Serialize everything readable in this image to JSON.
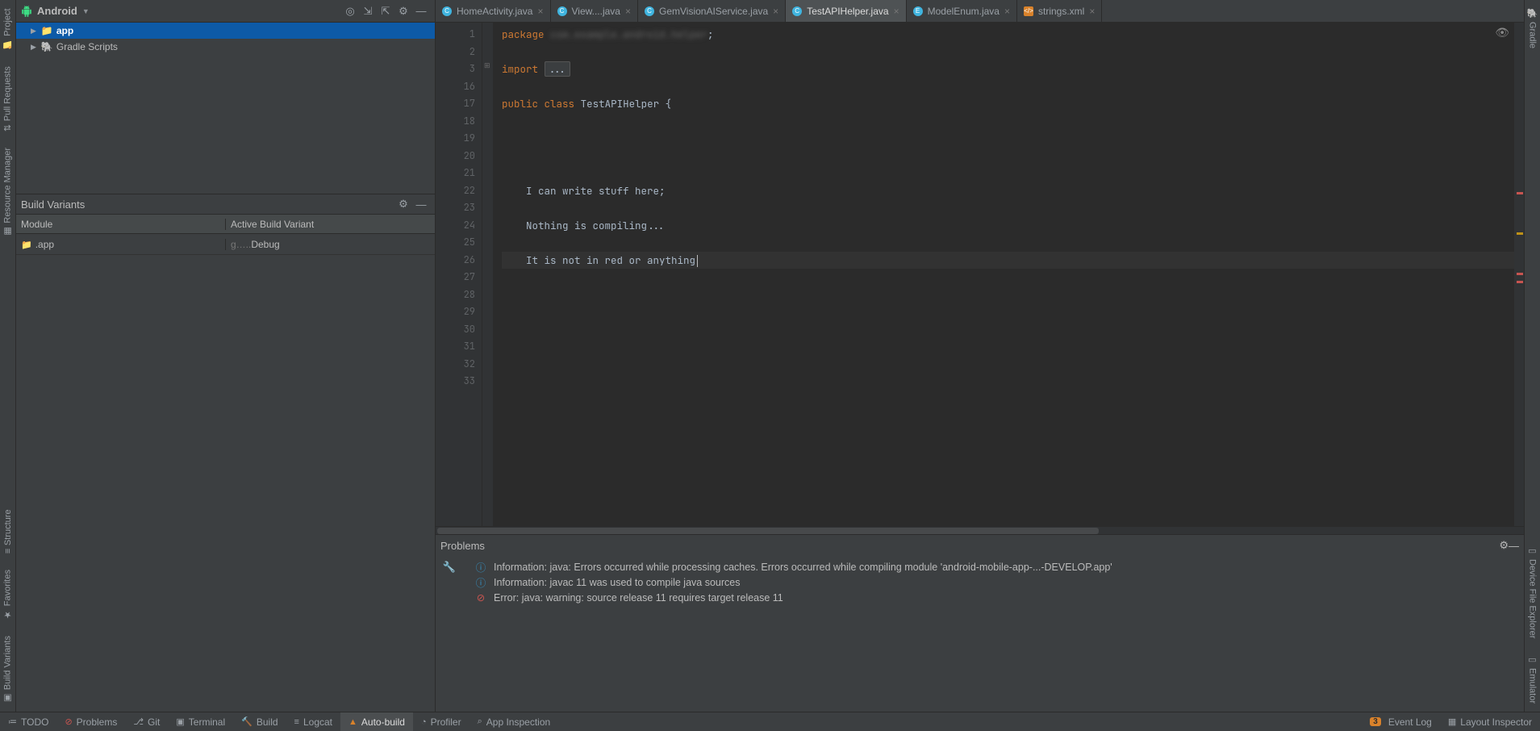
{
  "left_gutter": {
    "project": "Project",
    "pull_requests": "Pull Requests",
    "resource_manager": "Resource Manager",
    "structure": "Structure",
    "favorites": "Favorites",
    "build_variants": "Build Variants"
  },
  "right_gutter": {
    "gradle": "Gradle",
    "device_file_explorer": "Device File Explorer",
    "emulator": "Emulator"
  },
  "project_panel": {
    "dropdown": "Android",
    "tree": {
      "app": "app",
      "gradle_scripts": "Gradle Scripts"
    }
  },
  "build_variants": {
    "title": "Build Variants",
    "col_module": "Module",
    "col_variant": "Active Build Variant",
    "row_module": ".app",
    "row_variant_suffix": "Debug"
  },
  "tabs": [
    {
      "label": "HomeActivity.java",
      "type": "c"
    },
    {
      "label": "View....java",
      "type": "c"
    },
    {
      "label": "GemVisionAIService.java",
      "type": "c"
    },
    {
      "label": "TestAPIHelper.java",
      "type": "c",
      "active": true
    },
    {
      "label": "ModelEnum.java",
      "type": "e"
    },
    {
      "label": "strings.xml",
      "type": "xml"
    }
  ],
  "editor": {
    "package_kw": "package",
    "package_tail": ";",
    "import_kw": "import",
    "import_fold": "...",
    "decl_public": "public",
    "decl_class": "class",
    "decl_name": "TestAPIHelper",
    "decl_tail": " {",
    "line22": "I can write stuff here;",
    "line24": "Nothing is compiling...",
    "line26": "It is not in red or anything",
    "line_numbers": [
      "1",
      "2",
      "3",
      "16",
      "17",
      "18",
      "19",
      "20",
      "21",
      "22",
      "23",
      "24",
      "25",
      "26",
      "27",
      "28",
      "29",
      "30",
      "31",
      "32",
      "33"
    ]
  },
  "problems": {
    "title": "Problems",
    "rows": [
      {
        "type": "info",
        "text": "Information: java: Errors occurred while processing caches. Errors occurred while compiling module 'android-mobile-app-...-DEVELOP.app'"
      },
      {
        "type": "info",
        "text": "Information: javac 11 was used to compile java sources"
      },
      {
        "type": "error",
        "text": "Error: java: warning: source release 11 requires target release 11"
      }
    ]
  },
  "bottom_bar": {
    "todo": "TODO",
    "problems": "Problems",
    "git": "Git",
    "terminal": "Terminal",
    "build": "Build",
    "logcat": "Logcat",
    "auto_build": "Auto-build",
    "profiler": "Profiler",
    "app_inspection": "App Inspection",
    "event_log": "Event Log",
    "event_log_badge": "3",
    "layout_inspector": "Layout Inspector"
  }
}
